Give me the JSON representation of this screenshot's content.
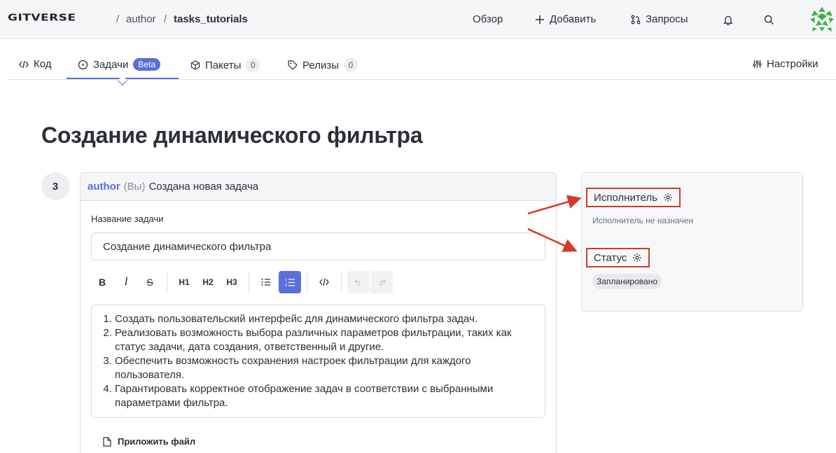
{
  "header": {
    "logo": "GITVERSE",
    "breadcrumb": [
      "author",
      "tasks_tutorials"
    ],
    "nav": [
      {
        "label": "Обзор",
        "icon": "none"
      },
      {
        "label": "Добавить",
        "icon": "plus-icon"
      },
      {
        "label": "Запросы",
        "icon": "pull-request-icon"
      }
    ],
    "icons": [
      "bell-icon",
      "search-icon",
      "avatar"
    ]
  },
  "tabs": [
    {
      "label": "Код",
      "icon": "code-icon"
    },
    {
      "label": "Задачи",
      "icon": "issue-icon",
      "badge": "Beta",
      "active": true
    },
    {
      "label": "Пакеты",
      "icon": "package-icon",
      "count": "0"
    },
    {
      "label": "Релизы",
      "icon": "tag-icon",
      "count": "0"
    }
  ],
  "settings_label": "Настройки",
  "page_title": "Создание динамического фильтра",
  "step_number": "3",
  "event": {
    "author": "author",
    "you": "(Вы)",
    "action": "Создана новая задача"
  },
  "form": {
    "title_label": "Название задачи",
    "title_value": "Создание динамического фильтра",
    "toolbar": [
      "B",
      "I",
      "S",
      "H1",
      "H2",
      "H3",
      "bullet-list",
      "ordered-list",
      "code",
      "undo",
      "redo"
    ],
    "body_items": [
      "Создать пользовательский интерфейс для динамического фильтра задач.",
      "Реализовать возможность выбора различных параметров фильтрации, таких как статус задачи, дата создания, ответственный и другие.",
      "Обеспечить возможность сохранения настроек фильтрации для каждого пользователя.",
      "Гарантировать корректное отображение задач в соответствии с выбранными параметрами фильтра."
    ],
    "attach_label": "Приложить файл"
  },
  "sidebar": {
    "assignee_label": "Исполнитель",
    "assignee_value": "Исполнитель не назначен",
    "status_label": "Статус",
    "status_value": "Запланировано"
  },
  "colors": {
    "accent": "#5b6fd8",
    "annotation": "#d23a2a"
  }
}
